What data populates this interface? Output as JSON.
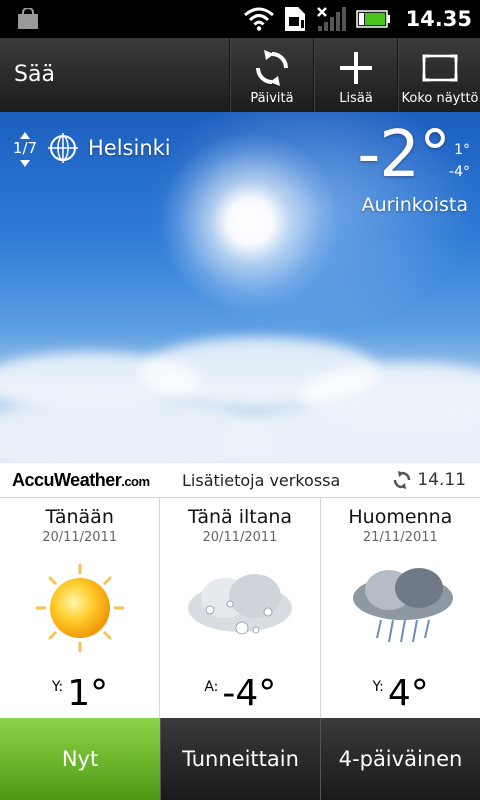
{
  "status_bar": {
    "time": "14.35",
    "icons": [
      "bag-icon",
      "wifi-icon",
      "sim-icon",
      "signal-icon",
      "battery-icon"
    ]
  },
  "action_bar": {
    "title": "Sää",
    "buttons": [
      {
        "label": "Päivitä",
        "icon": "refresh-icon"
      },
      {
        "label": "Lisää",
        "icon": "add-icon"
      },
      {
        "label": "Koko näyttö",
        "icon": "fullscreen-icon"
      }
    ]
  },
  "hero": {
    "pager": "1/7",
    "city": "Helsinki",
    "temperature": "-2°",
    "high": "1°",
    "low": "-4°",
    "condition": "Aurinkoista"
  },
  "accu": {
    "logo": "AccuWeather",
    "logo_com": ".com",
    "link": "Lisätietoja verkossa",
    "updated": "14.11"
  },
  "forecast": [
    {
      "title": "Tänään",
      "date": "20/11/2011",
      "prefix": "Y:",
      "temp": "1°",
      "icon": "sun-icon"
    },
    {
      "title": "Tänä iltana",
      "date": "20/11/2011",
      "prefix": "A:",
      "temp": "-4°",
      "icon": "snow-cloud-icon"
    },
    {
      "title": "Huomenna",
      "date": "21/11/2011",
      "prefix": "Y:",
      "temp": "4°",
      "icon": "rain-cloud-icon"
    }
  ],
  "tabs": [
    {
      "label": "Nyt",
      "active": true
    },
    {
      "label": "Tunneittain",
      "active": false
    },
    {
      "label": "4-päiväinen",
      "active": false
    }
  ]
}
